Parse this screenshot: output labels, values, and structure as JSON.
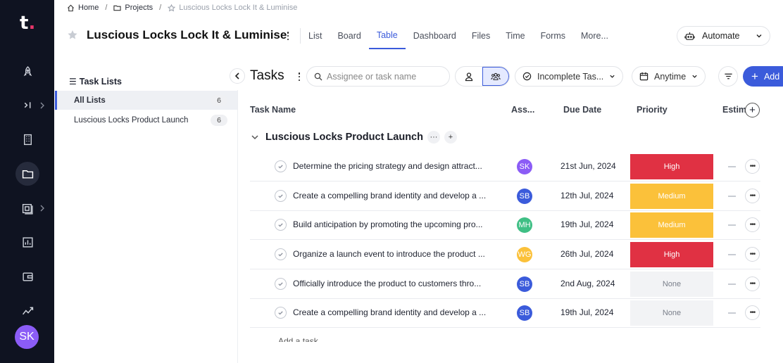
{
  "rail": {
    "logo": "t",
    "avatar_initials": "SK",
    "icons": [
      "rocket-icon",
      "collapse-arrow-icon",
      "building-icon",
      "folder-icon",
      "board-icon",
      "report-icon",
      "wallet-icon",
      "analytics-icon"
    ]
  },
  "breadcrumb": {
    "home": "Home",
    "projects": "Projects",
    "current": "Luscious Locks Lock It & Luminise",
    "sep": "/"
  },
  "header": {
    "title": "Luscious Locks Lock It & Luminise",
    "views": [
      "List",
      "Board",
      "Table",
      "Dashboard",
      "Files",
      "Time",
      "Forms",
      "More..."
    ],
    "active_view": "Table",
    "automate_label": "Automate"
  },
  "task_lists": {
    "title": "Task Lists",
    "items": [
      {
        "label": "All Lists",
        "count": "6"
      },
      {
        "label": "Luscious Locks Product Launch",
        "count": "6"
      }
    ]
  },
  "toolbar": {
    "title": "Tasks",
    "search_placeholder": "Assignee or task name",
    "filter_label": "Incomplete Tas...",
    "date_label": "Anytime",
    "add_label": "Add"
  },
  "table": {
    "columns": [
      "Task Name",
      "Ass...",
      "Due Date",
      "Priority",
      "Estim"
    ],
    "group_name": "Luscious Locks Product Launch",
    "rows": [
      {
        "name": "Determine the pricing strategy and design attract...",
        "assignee": "SK",
        "assignee_color": "#8b5cf6",
        "due": "21st Jun, 2024",
        "priority": "High",
        "priority_color": "#e03143"
      },
      {
        "name": "Create a compelling brand identity and develop a ...",
        "assignee": "SB",
        "assignee_color": "#3b5bdb",
        "due": "12th Jul, 2024",
        "priority": "Medium",
        "priority_color": "#fbc13a"
      },
      {
        "name": "Build anticipation by promoting the upcoming pro...",
        "assignee": "MH",
        "assignee_color": "#3fbf85",
        "due": "19th Jul, 2024",
        "priority": "Medium",
        "priority_color": "#fbc13a"
      },
      {
        "name": "Organize a launch event to introduce the product ...",
        "assignee": "WG",
        "assignee_color": "#fbc13a",
        "due": "26th Jul, 2024",
        "priority": "High",
        "priority_color": "#e03143"
      },
      {
        "name": "Officially introduce the product to customers thro...",
        "assignee": "SB",
        "assignee_color": "#3b5bdb",
        "due": "2nd Aug, 2024",
        "priority": "None",
        "priority_color": "#f2f3f5"
      },
      {
        "name": "Create a compelling brand identity and develop a ...",
        "assignee": "SB",
        "assignee_color": "#3b5bdb",
        "due": "19th Jul, 2024",
        "priority": "None",
        "priority_color": "#f2f3f5"
      }
    ],
    "add_task_label": "Add a task"
  }
}
